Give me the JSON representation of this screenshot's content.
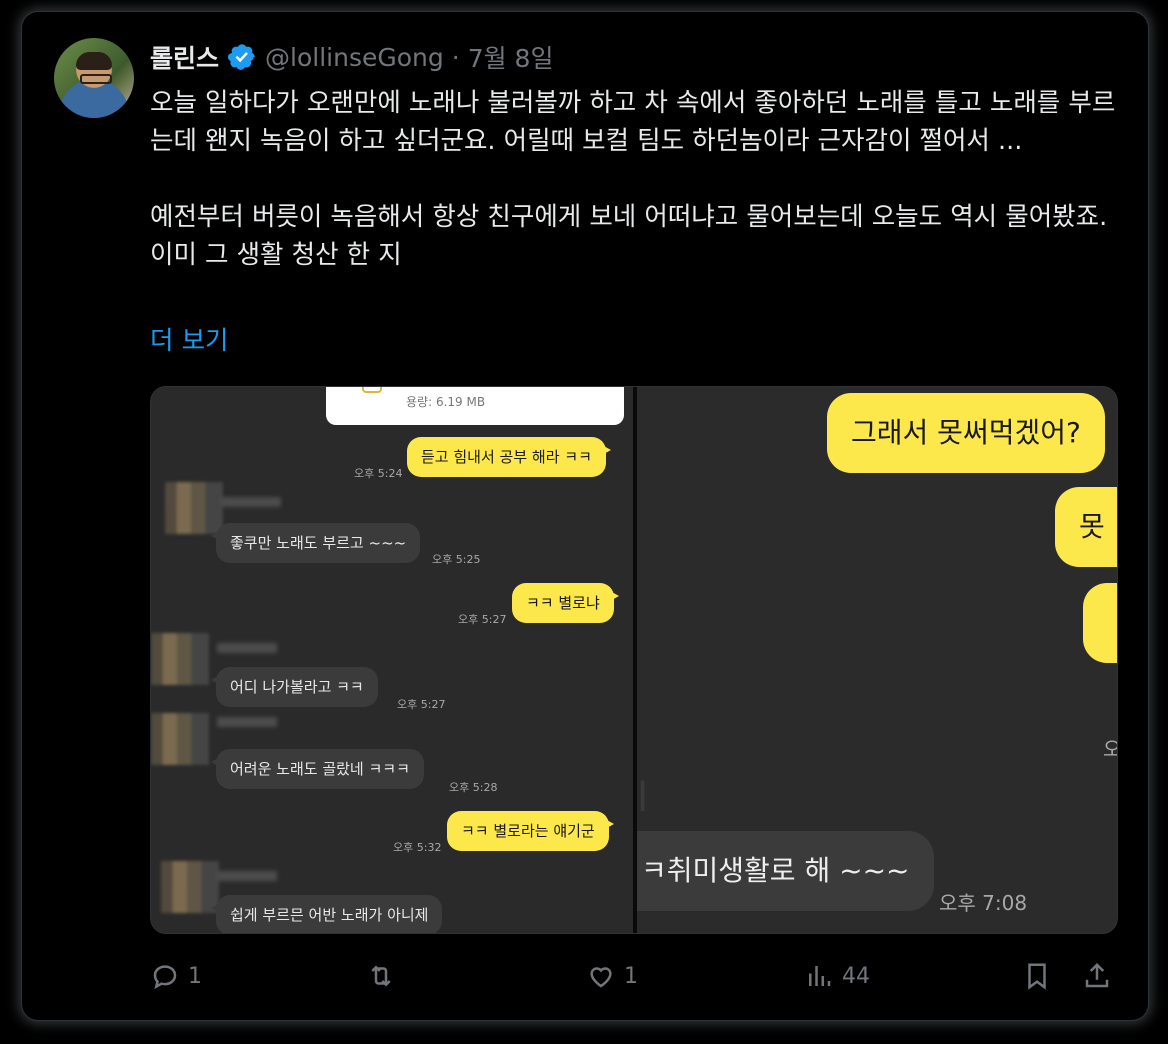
{
  "tweet": {
    "author_name": "롤린스",
    "handle": "@lollinseGong",
    "separator": "·",
    "date": "7월 8일",
    "text_p1": "오늘 일하다가 오랜만에 노래나 불러볼까 하고 차 속에서 좋아하던 노래를 틀고 노래를 부르는데 왠지 녹음이 하고 싶더군요. 어릴때 보컬 팀도 하던놈이라 근자감이 쩔어서 ...",
    "text_p2": "예전부터 버릇이 녹음해서 항상 친구에게 보네 어떠냐고 물어보는데 오늘도 역시 물어봤죠. 이미 그 생활 청산 한 지",
    "show_more": "더 보기"
  },
  "media": {
    "left_chat": {
      "file_size": "용량: 6.19 MB",
      "messages": [
        {
          "side": "me",
          "text": "듣고 힘내서 공부 해라 ㅋㅋ",
          "time": "오후 5:24"
        },
        {
          "side": "them",
          "text": "좋쿠만 노래도 부르고 ~~~",
          "time": "오후 5:25"
        },
        {
          "side": "me",
          "text": "ㅋㅋ 별로냐",
          "time": "오후 5:27"
        },
        {
          "side": "them",
          "text": "어디 나가볼라고 ㅋㅋ",
          "time": "오후 5:27"
        },
        {
          "side": "them",
          "text": "어려운 노래도 골랐네 ㅋㅋㅋ",
          "time": "오후 5:28"
        },
        {
          "side": "me",
          "text": "ㅋㅋ 별로라는 얘기군",
          "time": "오후 5:32"
        },
        {
          "side": "them",
          "text": "쉽게 부르믄 어반 노래가 아니제",
          "time": ""
        }
      ]
    },
    "right_chat": {
      "msg1": "그래서 못써먹겠어?",
      "msg2": "못",
      "msg3": "",
      "partial_time": "오",
      "ghost": "l",
      "them_msg": "ㅋ취미생활로 해 ~~~",
      "them_time": "오후 7:08"
    }
  },
  "actions": {
    "reply_count": "1",
    "retweet_count": "",
    "like_count": "1",
    "views_count": "44"
  },
  "colors": {
    "accent": "#1d9bf0",
    "kakao_yellow": "#fde84c",
    "muted": "#71767b"
  }
}
